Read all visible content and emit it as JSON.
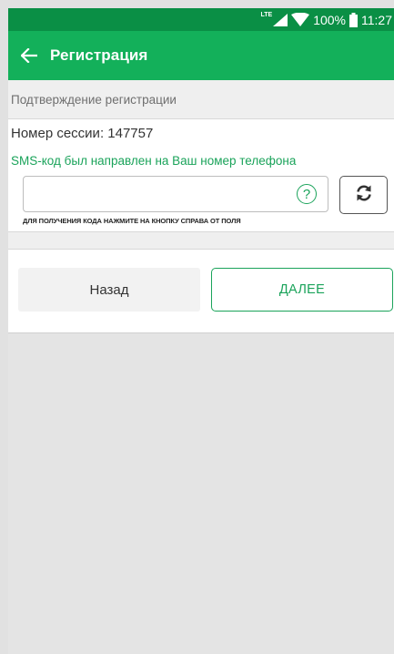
{
  "status_bar": {
    "network": "LTE",
    "battery": "100%",
    "time": "11:27"
  },
  "app_bar": {
    "title": "Регистрация",
    "back_icon": "arrow-left-icon"
  },
  "section": {
    "title": "Подтверждение регистрации"
  },
  "form": {
    "session_text": "Номер сессии: 147757",
    "sms_note": "SMS-код был направлен на Ваш номер телефона",
    "code_value": "",
    "code_placeholder": "",
    "help_symbol": "?",
    "hint": "ДЛЯ ПОЛУЧЕНИЯ КОДА НАЖМИТЕ НА КНОПКУ СПРАВА ОТ ПОЛЯ",
    "refresh_icon": "refresh-icon"
  },
  "actions": {
    "back_label": "Назад",
    "next_label": "ДАЛЕЕ"
  },
  "colors": {
    "status_bar": "#0a8f45",
    "app_bar": "#13b05a",
    "accent": "#1aa35a",
    "background": "#e4e4e4"
  }
}
